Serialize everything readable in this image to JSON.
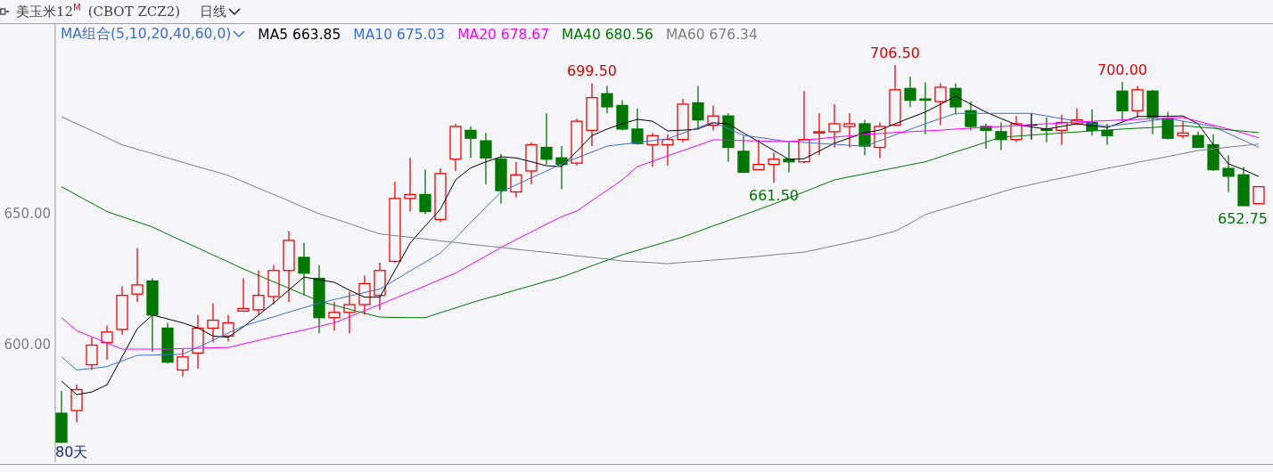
{
  "header": {
    "title": "美玉米12$^{M}$",
    "code": "(CBOT ZCZ2)",
    "period": "日线"
  },
  "indicator_bar": {
    "selector": "MA组合(5,10,20,40,60,0)",
    "readings": [
      "663.85",
      "675.03",
      "678.67",
      "680.56",
      "676.34"
    ]
  },
  "chart": {
    "range_label": "80天",
    "chart_data": {
      "type": "candlestick",
      "ylim": [
        554.8,
        722.1
      ],
      "yticks": [
        {
          "value": 600,
          "label": "600.00"
        },
        {
          "value": 650,
          "label": "650.00"
        }
      ],
      "annotations": [
        "699.50",
        "706.50",
        "700.00",
        "661.50",
        "652.75"
      ],
      "ohlc": [
        [
          573.5,
          582,
          562,
          562.5
        ],
        [
          574.5,
          584.5,
          570,
          582.5
        ],
        [
          592,
          602.5,
          590,
          599.5
        ],
        [
          600.5,
          607,
          594,
          604.5
        ],
        [
          605.5,
          622,
          603.5,
          618.5
        ],
        [
          619,
          636.5,
          616,
          622.5
        ],
        [
          624,
          625,
          597,
          611
        ],
        [
          606,
          608,
          592.5,
          593
        ],
        [
          590,
          598,
          587.5,
          595
        ],
        [
          596.5,
          611,
          590.5,
          606
        ],
        [
          606,
          615.5,
          600.5,
          609
        ],
        [
          603,
          611,
          601,
          608
        ],
        [
          612.5,
          625,
          612.5,
          613.5
        ],
        [
          613,
          628,
          611,
          618.5
        ],
        [
          618,
          630,
          615,
          628
        ],
        [
          628,
          643,
          616,
          639.5
        ],
        [
          633,
          638.5,
          618.5,
          627
        ],
        [
          625,
          630,
          604,
          610
        ],
        [
          610,
          616,
          605,
          612
        ],
        [
          612,
          620,
          604,
          615
        ],
        [
          615,
          626,
          611,
          623
        ],
        [
          618.5,
          631,
          613,
          628
        ],
        [
          631.5,
          662,
          631,
          655.5
        ],
        [
          655.5,
          671,
          650.5,
          657
        ],
        [
          657,
          666.5,
          649.5,
          650.5
        ],
        [
          647.5,
          667,
          646.5,
          665
        ],
        [
          670.5,
          684,
          666,
          683
        ],
        [
          681.5,
          683,
          671,
          678.5
        ],
        [
          677.5,
          680.5,
          661,
          671
        ],
        [
          670.5,
          672.5,
          653.5,
          658.5
        ],
        [
          658,
          669.5,
          656,
          664.5
        ],
        [
          666,
          677,
          661,
          676
        ],
        [
          675,
          688,
          668.5,
          670.5
        ],
        [
          671,
          675.5,
          659,
          668.5
        ],
        [
          669,
          686,
          668,
          685
        ],
        [
          681.5,
          699.5,
          675.5,
          694
        ],
        [
          695.5,
          698.5,
          688,
          690.5
        ],
        [
          691,
          693,
          681.5,
          682
        ],
        [
          682,
          690,
          676,
          676.5
        ],
        [
          676,
          680.5,
          667.5,
          679.5
        ],
        [
          676,
          680,
          668,
          678
        ],
        [
          678,
          693.5,
          677,
          691.5
        ],
        [
          692,
          698.5,
          682,
          685.5
        ],
        [
          683.5,
          691,
          681.5,
          687
        ],
        [
          687,
          688,
          669.5,
          675
        ],
        [
          673.5,
          679.5,
          665.5,
          665.5
        ],
        [
          666.5,
          678,
          666.5,
          668.5
        ],
        [
          668.5,
          673,
          661.5,
          670.5
        ],
        [
          670.5,
          677,
          665.5,
          669.5
        ],
        [
          669.5,
          696.5,
          669,
          678
        ],
        [
          680.5,
          688,
          672,
          681
        ],
        [
          681,
          691.5,
          675,
          684
        ],
        [
          683,
          688,
          675,
          684
        ],
        [
          684,
          685.5,
          672,
          675.5
        ],
        [
          675,
          684.5,
          671,
          683
        ],
        [
          683.5,
          706.5,
          683.5,
          697
        ],
        [
          697.5,
          702,
          690.5,
          693
        ],
        [
          693.5,
          699.8,
          680,
          693
        ],
        [
          692.5,
          699.5,
          683.5,
          698
        ],
        [
          697.5,
          699.5,
          687.5,
          690.5
        ],
        [
          689,
          692.5,
          681.5,
          683
        ],
        [
          683,
          684,
          674.5,
          681.5
        ],
        [
          681,
          684.5,
          674,
          678
        ],
        [
          678,
          687,
          677,
          684
        ],
        [
          683.5,
          688,
          678,
          683.5
        ],
        [
          682,
          686.5,
          677,
          681.5
        ],
        [
          681.5,
          687.5,
          676,
          684.5
        ],
        [
          684,
          690,
          683.5,
          685.5
        ],
        [
          684.5,
          689.5,
          679.5,
          681.5
        ],
        [
          681.5,
          684,
          676,
          679.5
        ],
        [
          696.5,
          700,
          685,
          689
        ],
        [
          689,
          698.5,
          686.5,
          697
        ],
        [
          696.5,
          697,
          680,
          686.5
        ],
        [
          686,
          688.5,
          678,
          678.5
        ],
        [
          679.5,
          685,
          678.5,
          680.5
        ],
        [
          679.5,
          681,
          675,
          675
        ],
        [
          676,
          680,
          666,
          666.5
        ],
        [
          667,
          672,
          658,
          664
        ],
        [
          664.5,
          667.5,
          652.75,
          652.75
        ],
        [
          653.5,
          660,
          653.5,
          660
        ]
      ]
    },
    "moving_averages": {
      "chart_data": {
        "type": "line",
        "ylim": [
          554.8,
          722.1
        ],
        "series": [
          {
            "name": "MA5",
            "color": "#000000",
            "values": [
              585.8,
              580.6,
              581.6,
              584.4,
              595,
              605.8,
              611,
              609.5,
              608,
              606,
              603,
              602.5,
              606.5,
              611,
              615.6,
              620.5,
              625.5,
              624.5,
              623.5,
              620.5,
              617.8,
              617.8,
              628,
              638.4,
              645,
              651.4,
              662.6,
              667.2,
              669.5,
              671.4,
              671,
              669.5,
              668,
              667.7,
              673.5,
              679.5,
              682,
              684,
              685.7,
              685,
              681.3,
              681.6,
              682,
              684.4,
              684,
              680.5,
              677.2,
              673.8,
              670.4,
              670.7,
              673.6,
              676.6,
              678.6,
              680.6,
              681.6,
              684,
              686.3,
              688.5,
              691.5,
              694.6,
              691.5,
              688.5,
              686,
              683.7,
              682.8,
              682,
              683,
              684,
              683.3,
              682.6,
              684.7,
              686.8,
              686.8,
              686.9,
              687,
              684,
              676,
              668.7,
              666.5,
              663.9
            ]
          },
          {
            "name": "MA10",
            "color": "#3a6fe0",
            "values": [
              595,
              590,
              590.6,
              591.3,
              593.5,
              595.6,
              595.7,
              595.9,
              596,
              598.7,
              601.4,
              604.1,
              606.8,
              608.6,
              610.3,
              612.1,
              613.8,
              615.6,
              616.9,
              618.3,
              619.6,
              620.9,
              624.3,
              627.8,
              631.2,
              634.6,
              640.4,
              646.3,
              652.1,
              658,
              660.7,
              663.4,
              666,
              668.7,
              671,
              673.2,
              675.5,
              676.2,
              676.9,
              677.6,
              678.3,
              680.4,
              682.6,
              684.7,
              682.1,
              679.6,
              678.8,
              678,
              677.2,
              676.9,
              676.5,
              676.2,
              675.8,
              675.5,
              677.6,
              679.8,
              681.9,
              684,
              686,
              688,
              688,
              688,
              688,
              688,
              688,
              687,
              686,
              685,
              684,
              683,
              683.8,
              684.5,
              685.3,
              686,
              685,
              684,
              683,
              680.3,
              677.7,
              675
            ]
          },
          {
            "name": "MA20",
            "color": "#ff00ff",
            "values": [
              610,
              605,
              602.7,
              600.3,
              598,
              598,
              598,
              598,
              598.2,
              598.3,
              598.5,
              598.6,
              600,
              601.3,
              602.7,
              604,
              605.3,
              606.7,
              608,
              610.3,
              612.7,
              615,
              617.4,
              619.7,
              622.1,
              624.6,
              627,
              630.3,
              633.5,
              636.8,
              639.8,
              642.7,
              645.7,
              648.6,
              650.7,
              654.7,
              658.6,
              662.6,
              667.7,
              669.7,
              671.8,
              673.8,
              675.8,
              677.9,
              677.8,
              677.6,
              677.5,
              677.3,
              677.2,
              677.8,
              678.3,
              678.9,
              679.4,
              680,
              680.3,
              680.7,
              681,
              681.3,
              681.6,
              682,
              682.3,
              682.7,
              683,
              683.3,
              683.7,
              684,
              684.3,
              684.7,
              685,
              685.2,
              685.5,
              685.7,
              685.9,
              686.2,
              686.4,
              685,
              683.5,
              682,
              680.4,
              678.7
            ]
          },
          {
            "name": "MA40",
            "color": "#007800",
            "values": [
              660,
              656.8,
              653.7,
              650.5,
              648.5,
              646.6,
              644.6,
              641.9,
              639.2,
              636.6,
              633.9,
              631.3,
              628.6,
              626.1,
              623.7,
              621.2,
              618.8,
              616.3,
              614.8,
              613.2,
              611.7,
              610.2,
              610.1,
              610,
              610,
              611.9,
              613.7,
              615.6,
              617.3,
              618.9,
              620.6,
              622.2,
              623.9,
              625.5,
              627.6,
              629.8,
              631.9,
              634,
              635.7,
              637.4,
              639.1,
              640.8,
              642.9,
              645,
              647.1,
              649.2,
              651.3,
              653.4,
              655.7,
              658,
              660.3,
              662.6,
              663.8,
              664.9,
              666.1,
              667.2,
              668.4,
              669.5,
              671.4,
              673.3,
              675.1,
              677,
              678.9,
              679.3,
              679.7,
              680.1,
              680.5,
              680.9,
              681.3,
              681.6,
              682,
              682.3,
              682.6,
              683,
              683.3,
              682.8,
              682.3,
              681.7,
              681.2,
              680.6
            ]
          },
          {
            "name": "MA60",
            "color": "#808080",
            "values": [
              686.7,
              684,
              681.4,
              678.7,
              676,
              674.3,
              672.7,
              671,
              669.3,
              667.6,
              666,
              664.3,
              661.9,
              659.4,
              657,
              654.6,
              652.1,
              649.7,
              647.8,
              645.9,
              643.9,
              642,
              641.3,
              640.7,
              640,
              639.3,
              638.7,
              638,
              637.4,
              636.8,
              636.1,
              635.5,
              634.9,
              634.3,
              633.6,
              633,
              632.4,
              631.6,
              631.3,
              631,
              630.6,
              631.1,
              631.5,
              632,
              632.4,
              632.9,
              633.4,
              634,
              634.5,
              635,
              636.2,
              637.5,
              638.7,
              640,
              641.5,
              643,
              646,
              649.4,
              651.1,
              652.8,
              654.5,
              656.2,
              657.9,
              659.6,
              660.8,
              662.1,
              663.3,
              664.5,
              665.8,
              667,
              668.1,
              669.3,
              670.4,
              671.5,
              672.7,
              673.8,
              674.4,
              675.1,
              675.7,
              676.3
            ]
          }
        ]
      }
    }
  }
}
